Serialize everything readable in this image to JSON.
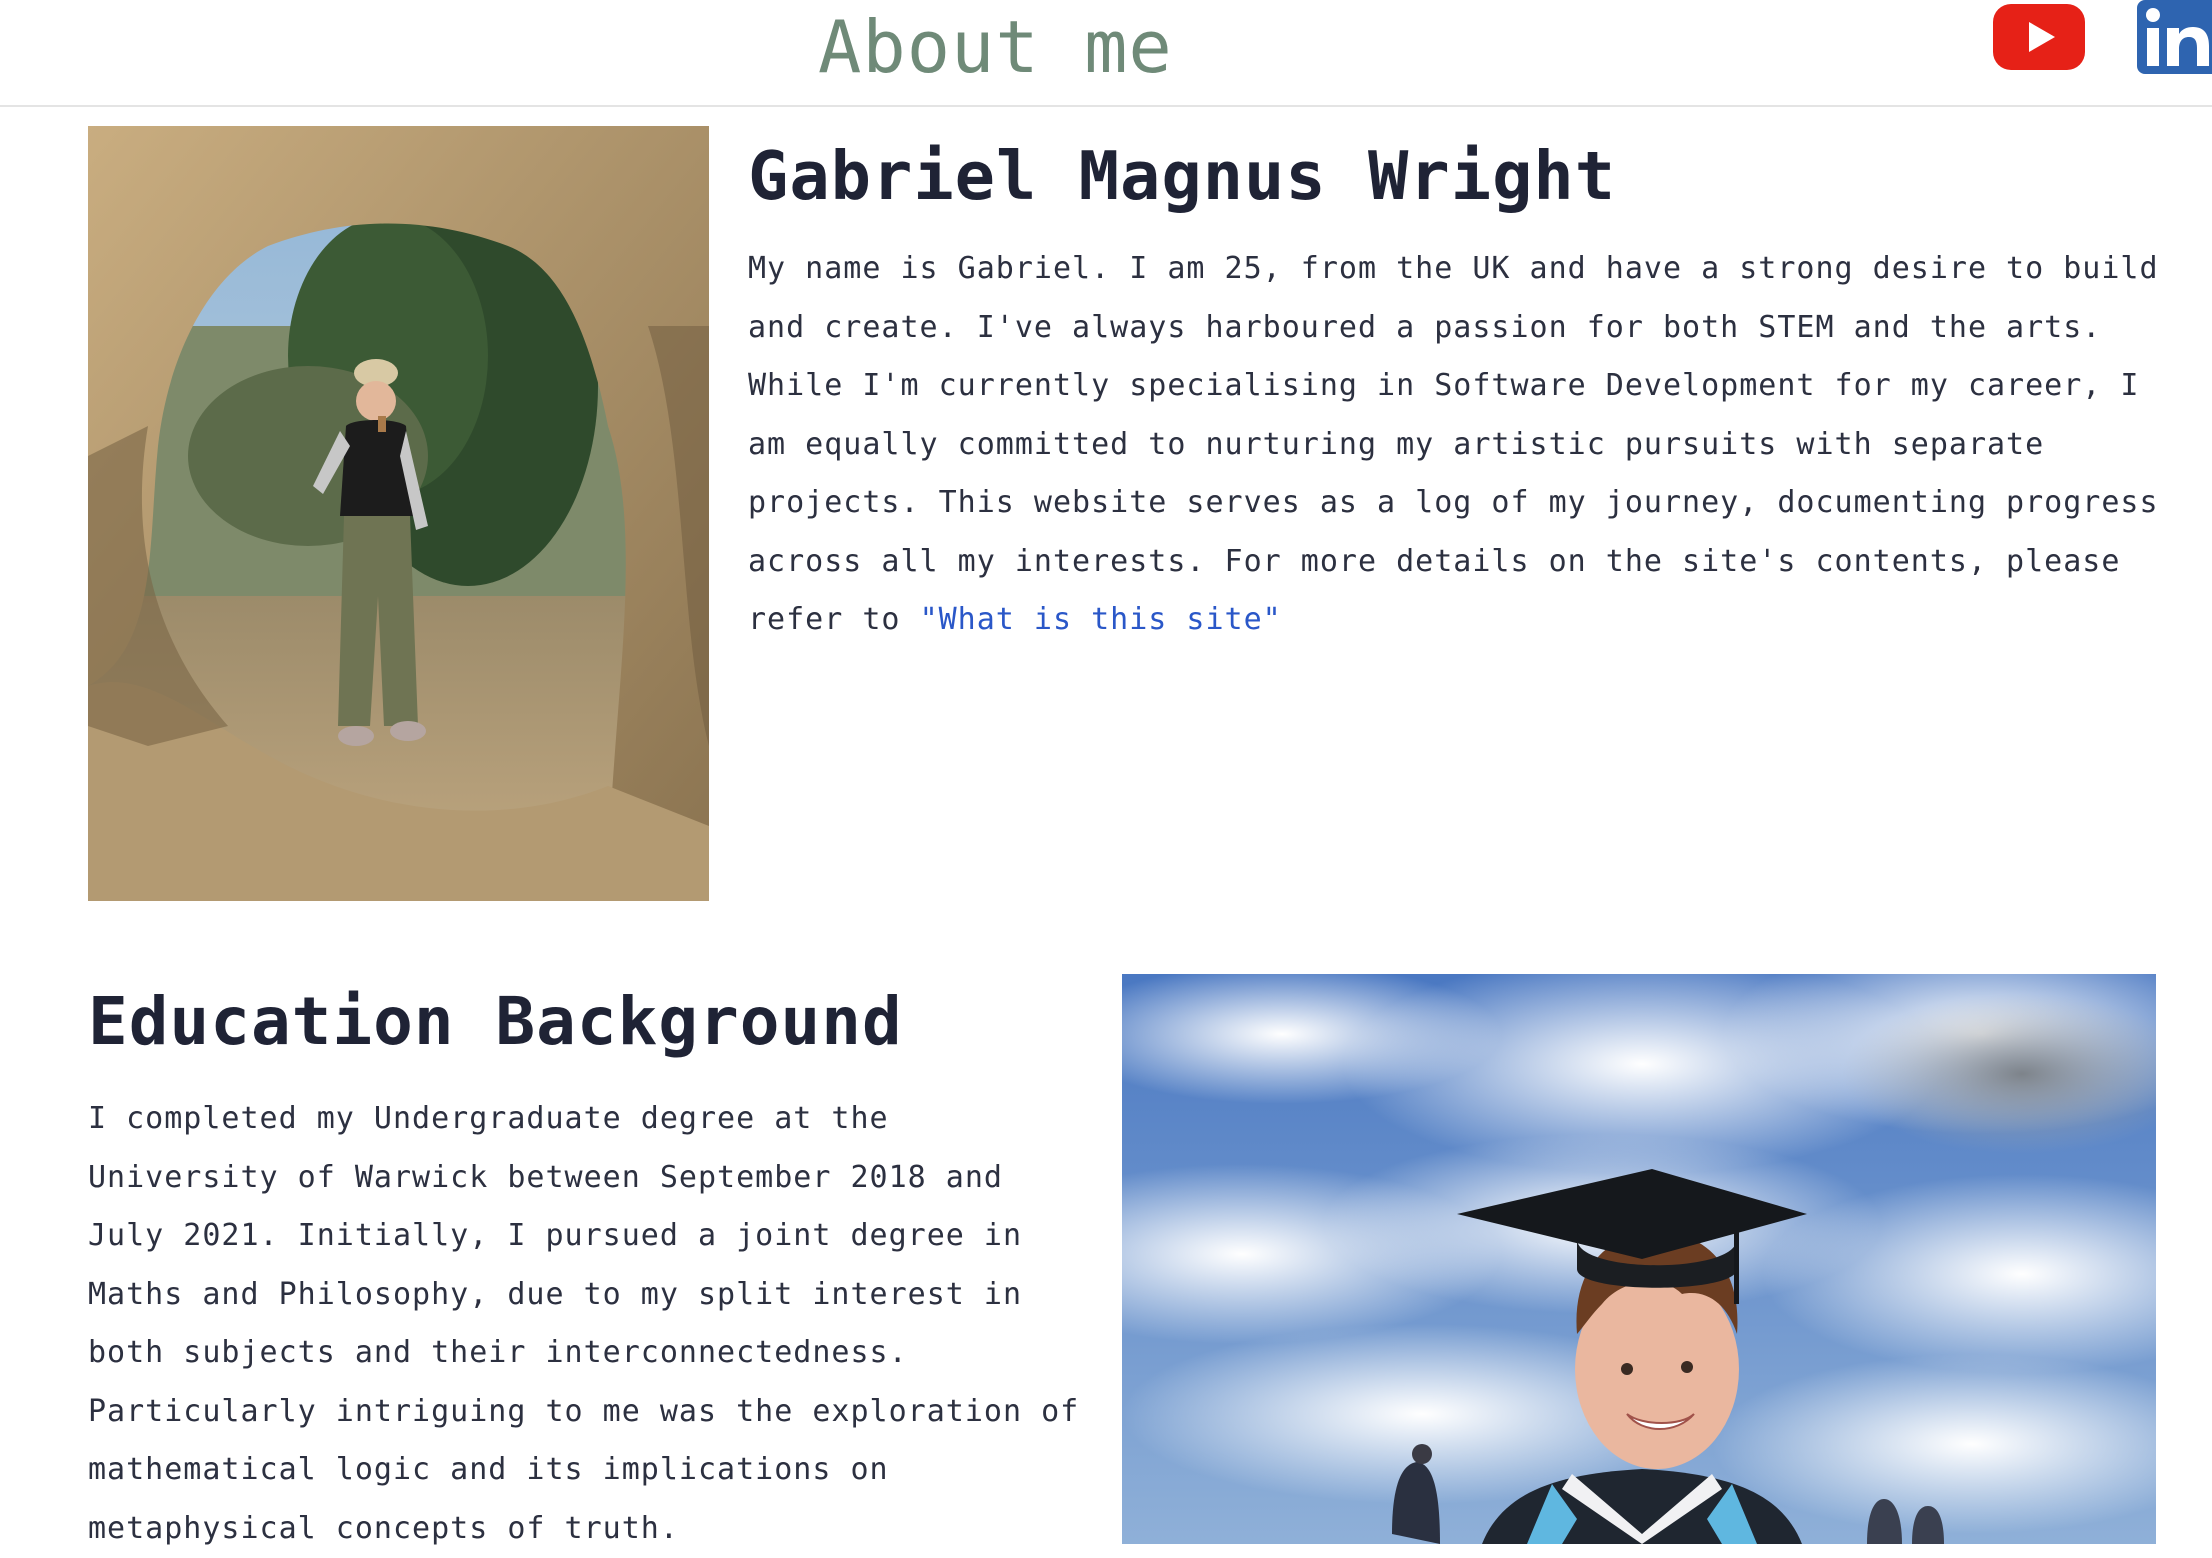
{
  "header": {
    "title": "About me",
    "social": [
      {
        "name": "youtube",
        "icon": "youtube-icon",
        "color": "#e62117"
      },
      {
        "name": "linkedin",
        "icon": "linkedin-icon",
        "color": "#2e64b0"
      }
    ]
  },
  "intro": {
    "photo_description_icon": "photo",
    "heading": "Gabriel Magnus Wright",
    "bio_text": "My name is Gabriel. I am 25, from the UK and have a strong desire to build and create. I've always harboured a passion for both STEM and the arts. While I'm currently specialising in Software Development for my career, I am equally committed to nurturing my artistic pursuits with separate projects. This website serves as a log of my journey, documenting progress across all my interests. For more details on the site's contents, please refer to ",
    "bio_link": "\"What is this site\""
  },
  "education": {
    "heading": "Education Background",
    "paragraph_1": "I completed my Undergraduate degree at the University of Warwick between September 2018 and July 2021. Initially, I pursued a joint degree in Maths and Philosophy, due to my split interest in both subjects and their interconnectedness. Particularly intriguing to me was the exploration of mathematical logic and its implications on metaphysical concepts of truth."
  },
  "colors": {
    "title": "#6f8a78",
    "link": "#2a57c8",
    "heading": "#1f2335"
  }
}
